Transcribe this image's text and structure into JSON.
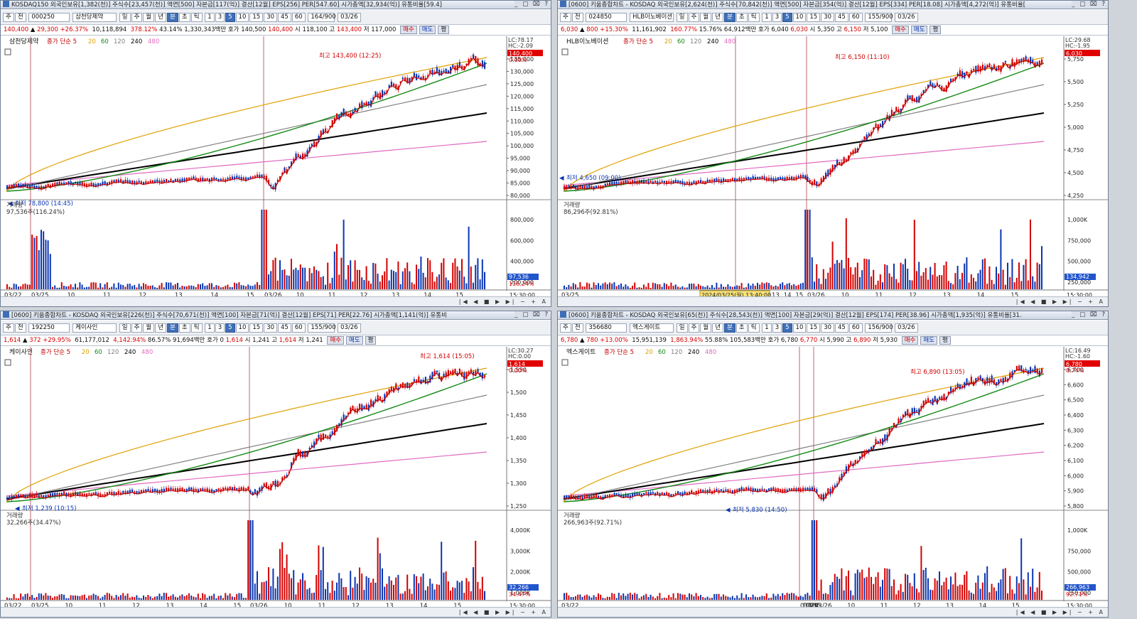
{
  "panels": [
    {
      "title": "KOSDAQ150 외국인보유[1,382(천)] 주식수[23,457(천)] 액면[500] 자본금[117(억)] 결산[12월] EPS[256] PER[547.60] 시가총액[32,934(억)] 유통비율[59.4]",
      "code": "000250",
      "name": "삼천당제약",
      "count": "164/900",
      "date": "03/26",
      "price": "140,400",
      "change": "29,300",
      "pct": "+26.37%",
      "volume": "10,118,894",
      "vol_ratio": "378.12%",
      "turnover": "43.14%",
      "amount": "1,330,343백만",
      "bid": "140,500",
      "ask": "140,400",
      "open": "118,100",
      "high": "143,400",
      "low": "117,000",
      "legend": "삼천당제약",
      "ma_label": "종가 단순 5",
      "ma_periods": [
        "20",
        "60",
        "120",
        "240",
        "480"
      ],
      "hi_note": "최고 143,400 (12:25)",
      "lo_note": "최저 78,800 (14:45)",
      "lc": "LC:78.17",
      "hc": "HC:-2.09",
      "pricebox": "140,400",
      "pct_box": "0.00%",
      "yticks": [
        "135,000",
        "130,000",
        "125,000",
        "120,000",
        "115,000",
        "110,000",
        "105,000",
        "100,000",
        "95,000",
        "90,000",
        "85,000",
        "80,000"
      ],
      "vol_label": "거래량",
      "vol_value": "97,536주(116.24%)",
      "vyticks": [
        "800,000",
        "600,000",
        "400,000",
        "200,000"
      ],
      "vbox": "97,536",
      "vbox2": "116.24%",
      "xticks": [
        "03/22",
        "03/25",
        "10",
        "11",
        "12",
        "13",
        "14",
        "15",
        "03/26",
        "10",
        "11",
        "12",
        "13",
        "14",
        "15"
      ],
      "time": "15:30:00",
      "dateTag": ""
    },
    {
      "title": "[0600] 키움종합차트 - KOSDAQ 외국인보유[2,624(천)] 주식수[70,842(천)] 액면[500] 자본금[354(억)] 결산[12월] EPS[334] PER[18.08] 시가총액[4,272(억)] 유통비율[",
      "code": "024850",
      "name": "HLB이노베이션",
      "count": "155/900",
      "date": "03/26",
      "price": "6,030",
      "change": "800",
      "pct": "+15.30%",
      "volume": "11,161,902",
      "vol_ratio": "160.77%",
      "turnover": "15.76%",
      "amount": "64,912백만",
      "bid": "6,040",
      "ask": "6,030",
      "open": "5,350",
      "high": "6,150",
      "low": "5,100",
      "legend": "HLB이노베이션",
      "ma_label": "종가 단순 5",
      "ma_periods": [
        "20",
        "60",
        "120",
        "240",
        "480"
      ],
      "hi_note": "최고 6,150 (11:10)",
      "lo_note": "최저 4,650 (09:00)",
      "lc": "LC:29.68",
      "hc": "HC:-1.95",
      "pricebox": "6,030",
      "pct_box": "",
      "yticks": [
        "5,750",
        "5,500",
        "5,250",
        "5,000",
        "4,750",
        "4,500",
        "4,250"
      ],
      "vol_label": "거래량",
      "vol_value": "86,296주(92.81%)",
      "vyticks": [
        "1,000K",
        "750,000",
        "500,000",
        "250,000"
      ],
      "vbox": "134,942",
      "vbox2": "",
      "xticks": [
        "03/25",
        "10",
        "11",
        "12",
        "13",
        "14",
        "15",
        "03/26",
        "10",
        "11",
        "12",
        "13",
        "14",
        "15"
      ],
      "time": "15:30:00",
      "dateTag": "2024/03/25(월) 13:40:00"
    },
    {
      "title": "[0600] 키움종합차트 - KOSDAQ 외국인보유[226(천)] 주식수[70,671(천)] 액면[100] 자본금[71(억)] 결산[12월] EPS[71] PER[22.76] 시가총액[1,141(억)] 유통비",
      "code": "192250",
      "name": "케이사인",
      "count": "155/900",
      "date": "03/26",
      "price": "1,614",
      "change": "372",
      "pct": "+29.95%",
      "volume": "61,177,012",
      "vol_ratio": "4,142.94%",
      "turnover": "86.57%",
      "amount": "91,694백만",
      "bid": "0",
      "ask": "1,614",
      "open": "1,241",
      "high": "1,614",
      "low": "1,241",
      "legend": "케이사인",
      "ma_label": "종가 단순 5",
      "ma_periods": [
        "20",
        "60",
        "120",
        "240",
        "480"
      ],
      "hi_note": "최고 1,614 (15:05)",
      "lo_note": "최저 1,239 (10:15)",
      "lc": "LC:30.27",
      "hc": "HC:0.00",
      "pricebox": "1,614",
      "pct_box": "0.00%",
      "yticks": [
        "1,550",
        "1,500",
        "1,450",
        "1,400",
        "1,350",
        "1,300",
        "1,250"
      ],
      "vol_label": "거래량",
      "vol_value": "32,266주(34.47%)",
      "vyticks": [
        "4,000K",
        "3,000K",
        "2,000K",
        "1,000K"
      ],
      "vbox": "32,266",
      "vbox2": "34.47%",
      "xticks": [
        "03/22",
        "03/25",
        "10",
        "11",
        "12",
        "13",
        "14",
        "15",
        "03/26",
        "10",
        "11",
        "12",
        "13",
        "14",
        "15"
      ],
      "time": "15:30:00",
      "dateTag": ""
    },
    {
      "title": "[0600] 키움종합차트 - KOSDAQ 외국인보유[65(천)] 주식수[28,543(천)] 액면[100] 자본금[29(억)] 결산[12월] EPS[174] PER[38.96] 시가총액[1,935(억)] 유통비율[31.",
      "code": "356680",
      "name": "엑스게이트",
      "count": "156/900",
      "date": "03/26",
      "price": "6,780",
      "change": "780",
      "pct": "+13.00%",
      "volume": "15,951,139",
      "vol_ratio": "1,863.94%",
      "turnover": "55.88%",
      "amount": "105,583백만",
      "bid": "6,780",
      "ask": "6,770",
      "open": "5,990",
      "high": "6,890",
      "low": "5,930",
      "legend": "엑스게이트",
      "ma_label": "종가 단순 5",
      "ma_periods": [
        "20",
        "60",
        "120",
        "240",
        "480"
      ],
      "hi_note": "최고 6,890 (13:05)",
      "lo_note": "최저 5,830 (14:50)",
      "lc": "LC:16.49",
      "hc": "HC:-1.60",
      "pricebox": "6,780",
      "pct_box": "0.74%",
      "yticks": [
        "6,700",
        "6,600",
        "6,500",
        "6,400",
        "6,300",
        "6,200",
        "6,100",
        "6,000",
        "5,900",
        "5,800"
      ],
      "vol_label": "거래량",
      "vol_value": "266,963주(92.71%)",
      "vyticks": [
        "1,000K",
        "750,000",
        "500,000",
        "250,000"
      ],
      "vbox": "266,963",
      "vbox2": "92.71%",
      "xticks": [
        "03/22",
        "03/25",
        "10",
        "11",
        "12",
        "13",
        "14",
        "15",
        "03/26",
        "10",
        "11",
        "12",
        "13",
        "14",
        "15"
      ],
      "time": "15:30:00",
      "dateTag": ""
    }
  ],
  "ui": {
    "periods": [
      "일",
      "주",
      "월",
      "년",
      "분",
      "초",
      "틱"
    ],
    "mins": [
      "1",
      "3",
      "5",
      "10",
      "15",
      "30",
      "45",
      "60"
    ],
    "buy": "매수",
    "sell": "매도",
    "avg": "평",
    "hoga": "호가",
    "o": "시",
    "h": "고",
    "l": "저",
    "jeon": "전",
    "ju": "주",
    "ctl": "_ □ ⌧ ?"
  },
  "colors": {
    "up": "#d40000",
    "down": "#0b36b0",
    "ma5": "#c00000",
    "ma20": "#e0a000",
    "ma60": "#138a13",
    "ma120": "#808080",
    "ma240": "#000000",
    "ma480": "#e06ac0"
  }
}
